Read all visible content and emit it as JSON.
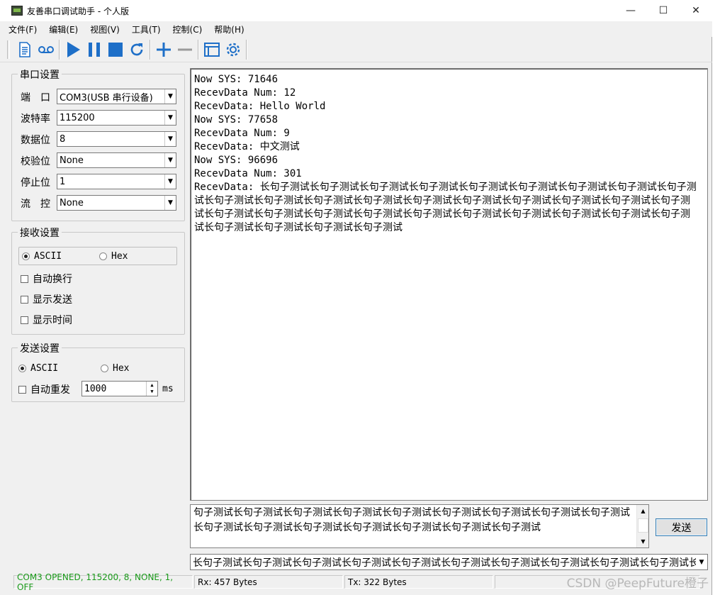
{
  "window": {
    "title": "友善串口调试助手 - 个人版",
    "controls": [
      "—",
      "☐",
      "✕"
    ]
  },
  "menu": [
    "文件(F)",
    "编辑(E)",
    "视图(V)",
    "工具(T)",
    "控制(C)",
    "帮助(H)"
  ],
  "toolbar": {
    "icons": [
      "new-document-icon",
      "record-icon",
      "play-icon",
      "pause-icon",
      "stop-icon",
      "refresh-icon",
      "add-icon",
      "remove-icon",
      "window-icon",
      "settings-icon"
    ],
    "accent": "#1e6fc8"
  },
  "port_settings": {
    "title": "串口设置",
    "rows": [
      {
        "label": "端　口",
        "value": "COM3(USB 串行设备)"
      },
      {
        "label": "波特率",
        "value": "115200"
      },
      {
        "label": "数据位",
        "value": "8"
      },
      {
        "label": "校验位",
        "value": "None"
      },
      {
        "label": "停止位",
        "value": "1"
      },
      {
        "label": "流　控",
        "value": "None"
      }
    ]
  },
  "recv_settings": {
    "title": "接收设置",
    "ascii_label": "ASCII",
    "hex_label": "Hex",
    "selected": "ASCII",
    "options": [
      "自动换行",
      "显示发送",
      "显示时间"
    ]
  },
  "send_settings": {
    "title": "发送设置",
    "ascii_label": "ASCII",
    "hex_label": "Hex",
    "selected": "ASCII",
    "auto_resend_label": "自动重发",
    "interval_value": "1000",
    "interval_unit": "ms"
  },
  "receive": {
    "lines": [
      "Now SYS: 71646",
      "RecevData Num: 12",
      "RecevData: Hello World",
      "Now SYS: 77658",
      "RecevData Num: 9",
      "RecevData: 中文测试",
      "Now SYS: 96696",
      "RecevData Num: 301"
    ],
    "long_line": "RecevData: 长句子测试长句子测试长句子测试长句子测试长句子测试长句子测试长句子测试长句子测试长句子测试长句子测试长句子测试长句子测试长句子测试长句子测试长句子测试长句子测试长句子测试长句子测试长句子测试长句子测试长句子测试长句子测试长句子测试长句子测试长句子测试长句子测试长句子测试长句子测试长句子测试长句子测试长句子测试长句子测试长句子测试"
  },
  "send": {
    "text": "句子测试长句子测试长句子测试长句子测试长句子测试长句子测试长句子测试长句子测试长句子测试长句子测试长句子测试长句子测试长句子测试长句子测试长句子测试长句子测试",
    "button_label": "发送",
    "history_value": "长句子测试长句子测试长句子测试长句子测试长句子测试长句子测试长句子测试长句子测试长句子测试长句子测试长句"
  },
  "status": {
    "port": "COM3 OPENED, 115200, 8, NONE, 1, OFF",
    "rx": "Rx: 457 Bytes",
    "tx": "Tx: 322 Bytes",
    "port_color": "#1a9a1a"
  },
  "watermark": "CSDN @PeepFuture橙子"
}
